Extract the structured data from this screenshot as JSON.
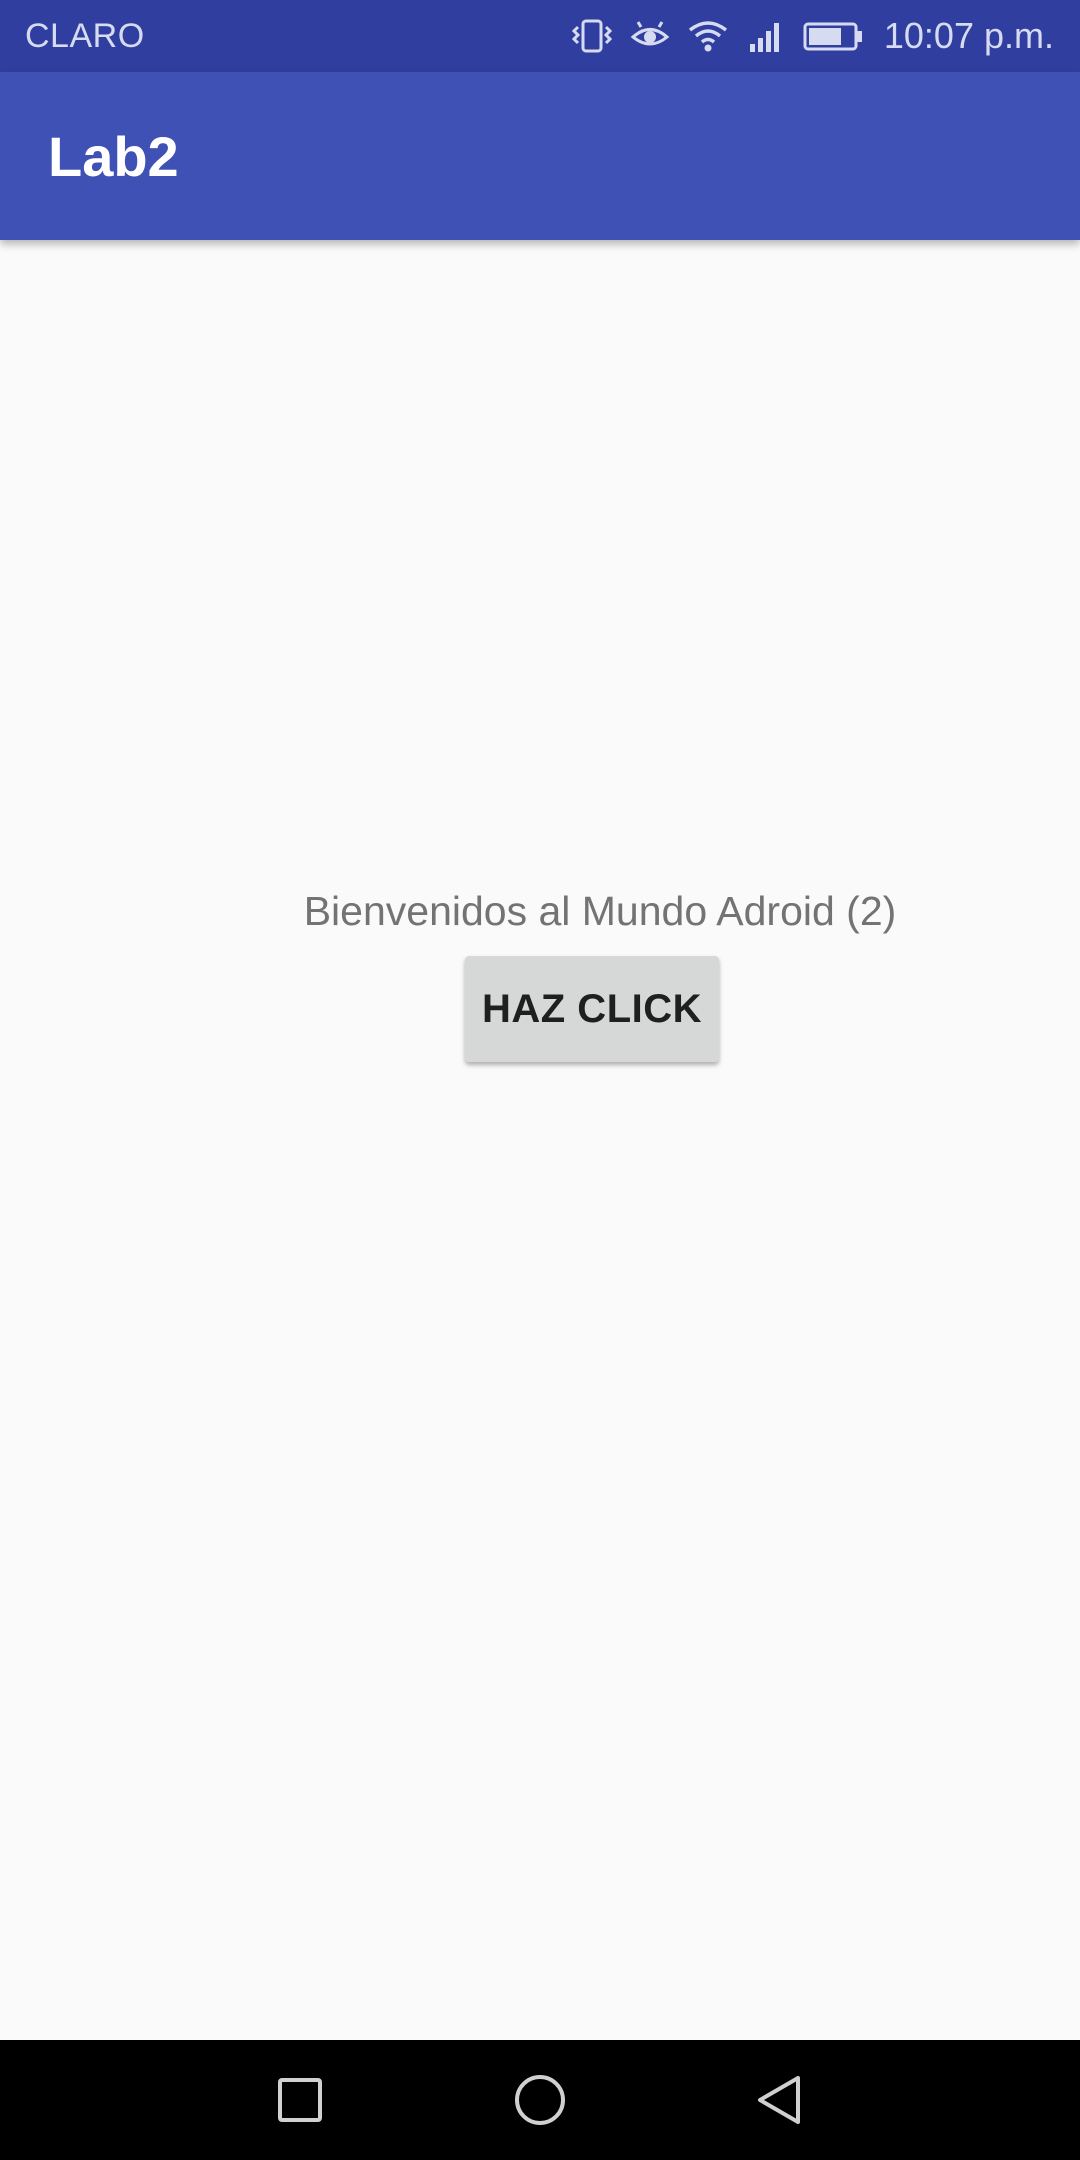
{
  "status_bar": {
    "carrier": "CLARO",
    "time": "10:07 p.m.",
    "icons": [
      "vibrate-icon",
      "eye-icon",
      "wifi-icon",
      "signal-icon",
      "battery-icon"
    ],
    "battery_level": 0.75,
    "background_color": "#303f9f"
  },
  "app_bar": {
    "title": "Lab2",
    "background_color": "#3f51b5"
  },
  "main": {
    "welcome_text": "Bienvenidos al Mundo Adroid (2)",
    "button_label": "HAZ CLICK"
  },
  "nav_bar": {
    "buttons": [
      "recents-icon",
      "home-icon",
      "back-icon"
    ]
  }
}
